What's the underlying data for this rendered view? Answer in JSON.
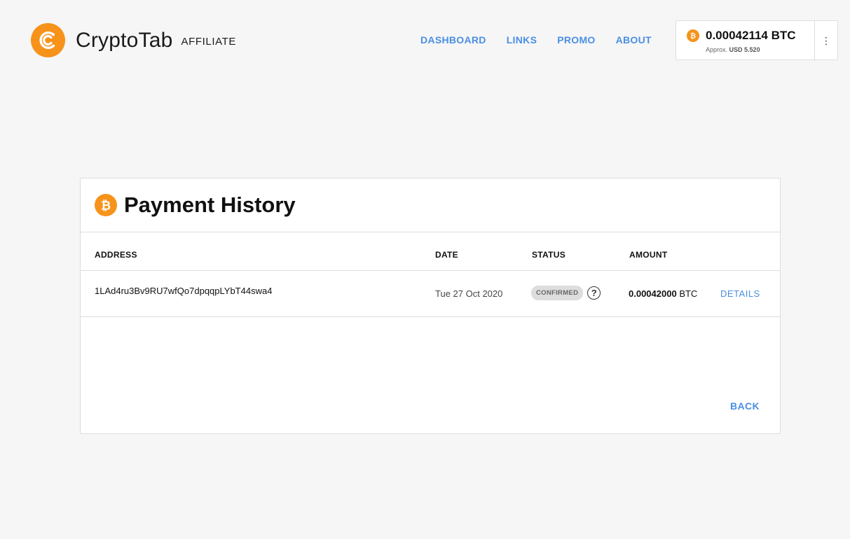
{
  "brand": {
    "name": "CryptoTab",
    "suffix": "AFFILIATE",
    "accent": "#f7931a"
  },
  "nav": {
    "items": [
      {
        "label": "DASHBOARD"
      },
      {
        "label": "LINKS"
      },
      {
        "label": "PROMO"
      },
      {
        "label": "ABOUT"
      }
    ],
    "color": "#4a8fe3"
  },
  "balance": {
    "btc": "0.00042114 BTC",
    "approx_label": "Approx.",
    "usd": "USD 5.520",
    "icon": "bitcoin-icon",
    "menu_icon": "more-vertical-icon"
  },
  "page": {
    "title": "Payment History",
    "title_icon": "bitcoin-icon"
  },
  "table": {
    "columns": [
      "ADDRESS",
      "DATE",
      "STATUS",
      "AMOUNT"
    ],
    "rows": [
      {
        "address": "1LAd4ru3Bv9RU7wfQo7dpqqpLYbT44swa4",
        "date": "Tue 27 Oct 2020",
        "status": "CONFIRMED",
        "amount_value": "0.00042000",
        "amount_unit": "BTC",
        "action": "DETAILS"
      }
    ]
  },
  "footer": {
    "back_label": "BACK"
  }
}
